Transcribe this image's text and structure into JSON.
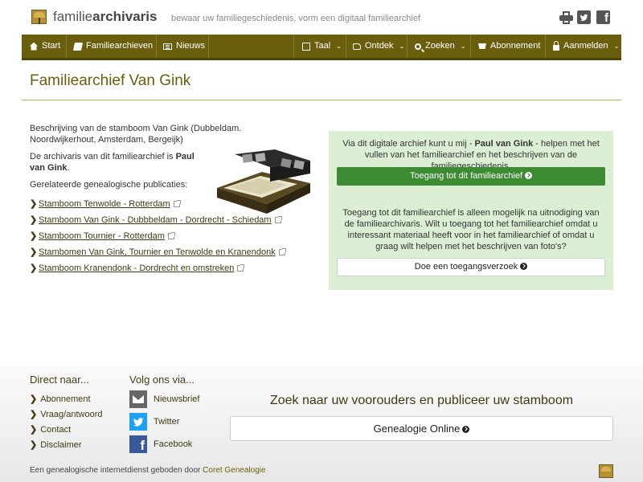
{
  "header": {
    "logo_text_light": "familie",
    "logo_text_bold": "archivaris",
    "tagline": "bewaar uw familiegeschiedenis, vorm een digitaal familiearchief"
  },
  "nav": {
    "start": "Start",
    "familiearchieven": "Familiearchieven",
    "nieuws": "Nieuws",
    "taal": "Taal",
    "ontdek": "Ontdek",
    "zoeken": "Zoeken",
    "abonnement": "Abonnement",
    "aanmelden": "Aanmelden"
  },
  "page": {
    "title": "Familiearchief Van Gink",
    "description": "Beschrijving van de stamboom Van Gink (Dubbeldam. Noordwijkerhout, Amsterdam, Bergeijk)",
    "archivist_prefix": "De archivaris van dit familiearchief is ",
    "archivist_name": "Paul van Gink",
    "archivist_suffix": ".",
    "publications_label": "Gerelateerde genealogische publicaties:",
    "publications": [
      "Stamboom Tenwolde - Rotterdam",
      "Stamboom Van Gink - Dubbbeldam - Dordrecht - Schiedam",
      "Stamboom Tournier - Rotterdam",
      "Stambomen Van Gink, Tournier en Tenwolde en Kranendonk",
      "Stamboom Kranendonk - Dordrecht en omstreken"
    ]
  },
  "panel": {
    "intro_prefix": "Via dit digitale archief kunt u mij - ",
    "intro_name": "Paul van Gink",
    "intro_suffix": " - helpen met het vullen van het familiearchief en het beschrijven van de familiegeschiedenis.",
    "access_button": "Toegang tot dit familiearchief",
    "invite_text": "Toegang tot dit familiearchief is alleen mogelijk na uitnodiging van de familiearchivaris. Wilt u toegang tot het familiearchief omdat u interessant materiaal heeft voor in het familiearchief of omdat u graag wilt helpen met het beschrijven van foto's?",
    "request_button": "Doe een toegangsverzoek"
  },
  "footer": {
    "direct_heading": "Direct naar...",
    "direct_links": [
      "Abonnement",
      "Vraag/antwoord",
      "Contact",
      "Disclaimer"
    ],
    "follow_heading": "Volg ons via...",
    "social": [
      "Nieuwsbrief",
      "Twitter",
      "Facebook"
    ],
    "promo_title": "Zoek naar uw voorouders en publiceer uw stamboom",
    "promo_button": "Genealogie Online",
    "credit_prefix": "Een genealogische internetdienst geboden door ",
    "credit_link": "Coret Genealogie"
  },
  "colors": {
    "nav": "#6a5e0d",
    "title": "#6a5e0d",
    "panel_bg": "#dcefd4",
    "access_button": "#3c8a32"
  }
}
